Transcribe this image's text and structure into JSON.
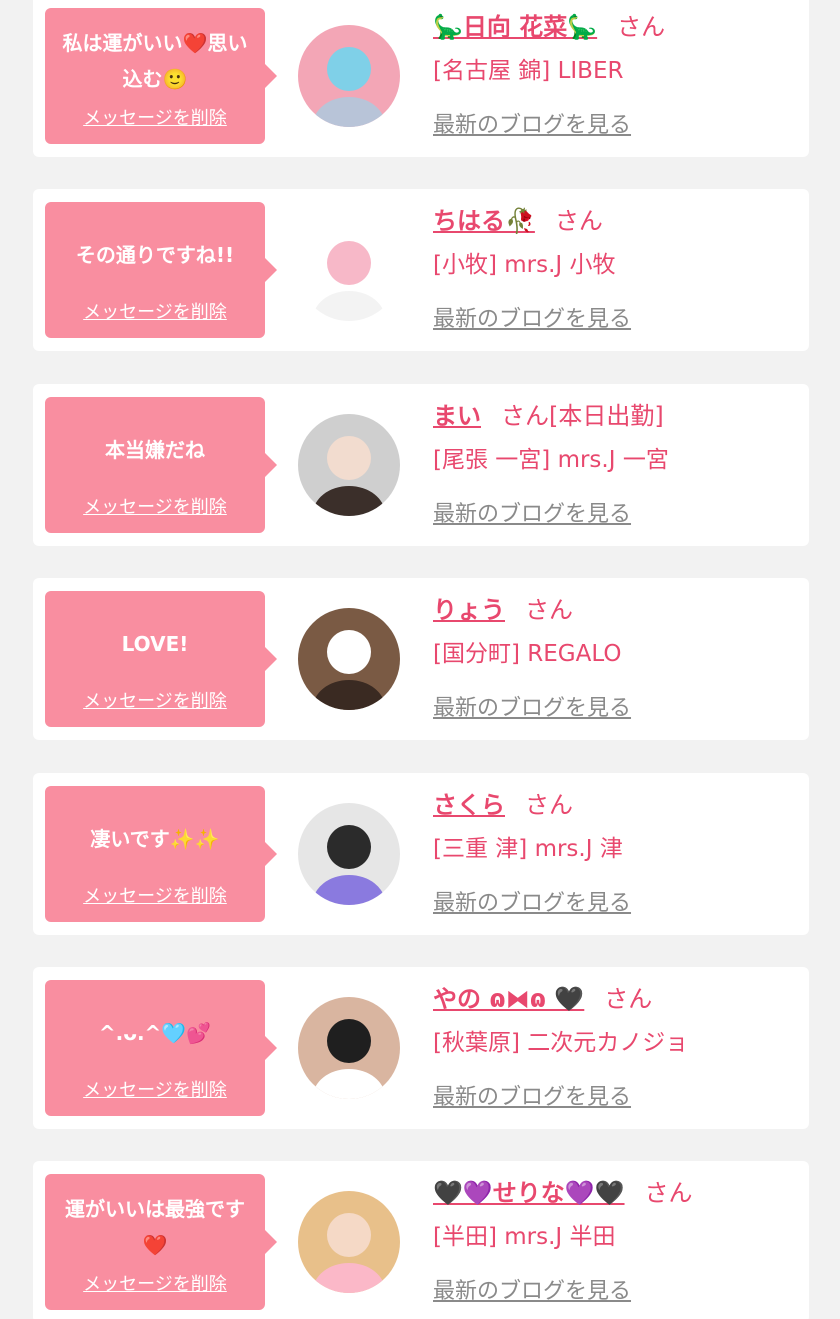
{
  "theme": {
    "bubble": "#f98ea0",
    "name": "#e8486e",
    "link_gray": "#8a8a8a",
    "background": "#f2f2f2"
  },
  "cards": [
    {
      "message": "私は運がいい❤️思い込む🙂",
      "delete_label": "メッセージを削除",
      "name": "🦕日向 花菜🦕",
      "suffix": "さん",
      "shop": "[名古屋 錦] LIBER",
      "blog_label": "最新のブログを見る",
      "avatar_icon": "ball-pit-photo-icon",
      "avatar_colors": [
        "#f3a6b6",
        "#7fd0e8",
        "#b8c4d8"
      ]
    },
    {
      "message": "その通りですね!!",
      "delete_label": "メッセージを削除",
      "name": "ちはる🥀",
      "suffix": "さん",
      "shop": "[小牧] mrs.J 小牧",
      "blog_label": "最新のブログを見る",
      "avatar_icon": "my-melody-plush-icon",
      "avatar_colors": [
        "#ffffff",
        "#f7b8c8",
        "#f3f3f3"
      ]
    },
    {
      "message": "本当嫌だね",
      "delete_label": "メッセージを削除",
      "name": "まい",
      "suffix": "さん[本日出勤]",
      "shop": "[尾張 一宮] mrs.J 一宮",
      "blog_label": "最新のブログを見る",
      "avatar_icon": "woman-selfie-photo-icon",
      "avatar_colors": [
        "#cfcfcf",
        "#f2dccf",
        "#3b2f2a"
      ]
    },
    {
      "message": "LOVE!",
      "delete_label": "メッセージを削除",
      "name": "りょう",
      "suffix": "さん",
      "shop": "[国分町] REGALO",
      "blog_label": "最新のブログを見る",
      "avatar_icon": "masked-face-photo-icon",
      "avatar_colors": [
        "#7a5a44",
        "#ffffff",
        "#3a2a22"
      ]
    },
    {
      "message": "凄いです✨✨",
      "delete_label": "メッセージを削除",
      "name": "さくら",
      "suffix": "さん",
      "shop": "[三重 津] mrs.J 津",
      "blog_label": "最新のブログを見る",
      "avatar_icon": "butterfly-selfie-photo-icon",
      "avatar_colors": [
        "#e6e6e6",
        "#2b2b2b",
        "#8a7adf"
      ]
    },
    {
      "message": "^.ᴗ.^🩵💕",
      "delete_label": "メッセージを削除",
      "name": "やの ɷ⧓ɷ  🖤",
      "suffix": "さん",
      "shop": "[秋葉原] 二次元カノジョ",
      "blog_label": "最新のブログを見る",
      "avatar_icon": "maid-girl-photo-icon",
      "avatar_colors": [
        "#d9b5a0",
        "#1f1f1f",
        "#ffffff"
      ]
    },
    {
      "message": "運がいいは最強です❤️",
      "delete_label": "メッセージを削除",
      "name": "🖤💜せりな💜🖤",
      "suffix": "さん",
      "shop": "[半田] mrs.J 半田",
      "blog_label": "最新のブログを見る",
      "avatar_icon": "blonde-woman-photo-icon",
      "avatar_colors": [
        "#e8c08a",
        "#f5d9c6",
        "#fbb8c8"
      ]
    }
  ]
}
